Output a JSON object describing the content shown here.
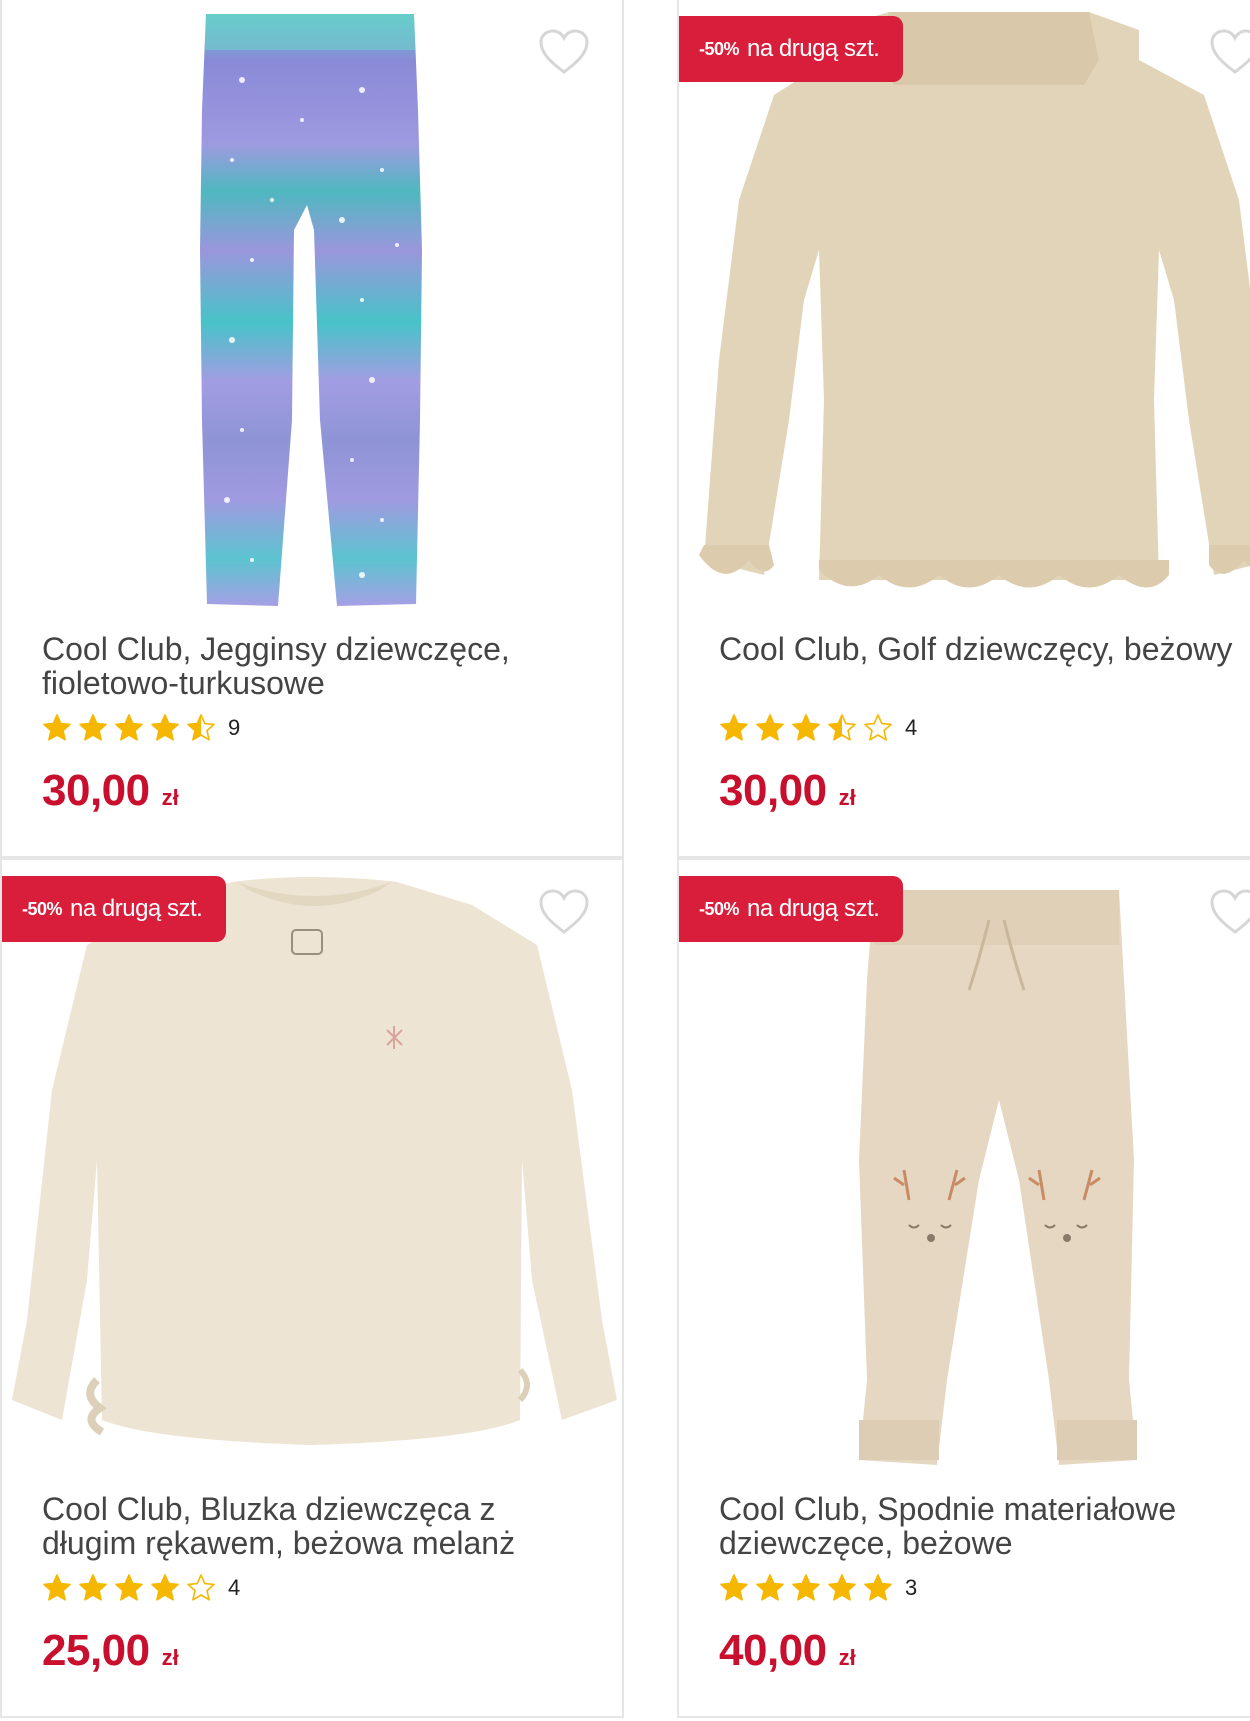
{
  "colors": {
    "badge": "#d81e3a",
    "price": "#c8102e",
    "star_filled": "#f5b700",
    "star_empty": "#f5b700",
    "heart_outline": "#d6d6d6",
    "card_border": "#e6e6e6"
  },
  "products": [
    {
      "title": "Cool Club, Jegginsy dziewczęce,\nfioletowo-turkusowe",
      "rating": 4.5,
      "review_count": "9",
      "price": "30,00",
      "currency": "zł",
      "badge_pct": "",
      "badge_text": "",
      "image_icon": "leggings-image"
    },
    {
      "title": "Cool Club, Golf dziewczęcy, beżowy",
      "rating": 3.5,
      "review_count": "4",
      "price": "30,00",
      "currency": "zł",
      "badge_pct": "-50%",
      "badge_text": "na drugą szt.",
      "image_icon": "sweater-image"
    },
    {
      "title": "Cool Club, Bluzka dziewczęca z\ndługim rękawem, beżowa melanż",
      "rating": 4,
      "review_count": "4",
      "price": "25,00",
      "currency": "zł",
      "badge_pct": "-50%",
      "badge_text": "na drugą szt.",
      "image_icon": "blouse-image"
    },
    {
      "title": "Cool Club, Spodnie materiałowe\ndziewczęce, beżowe",
      "rating": 5,
      "review_count": "3",
      "price": "40,00",
      "currency": "zł",
      "badge_pct": "-50%",
      "badge_text": "na drugą szt.",
      "image_icon": "trousers-image"
    }
  ]
}
